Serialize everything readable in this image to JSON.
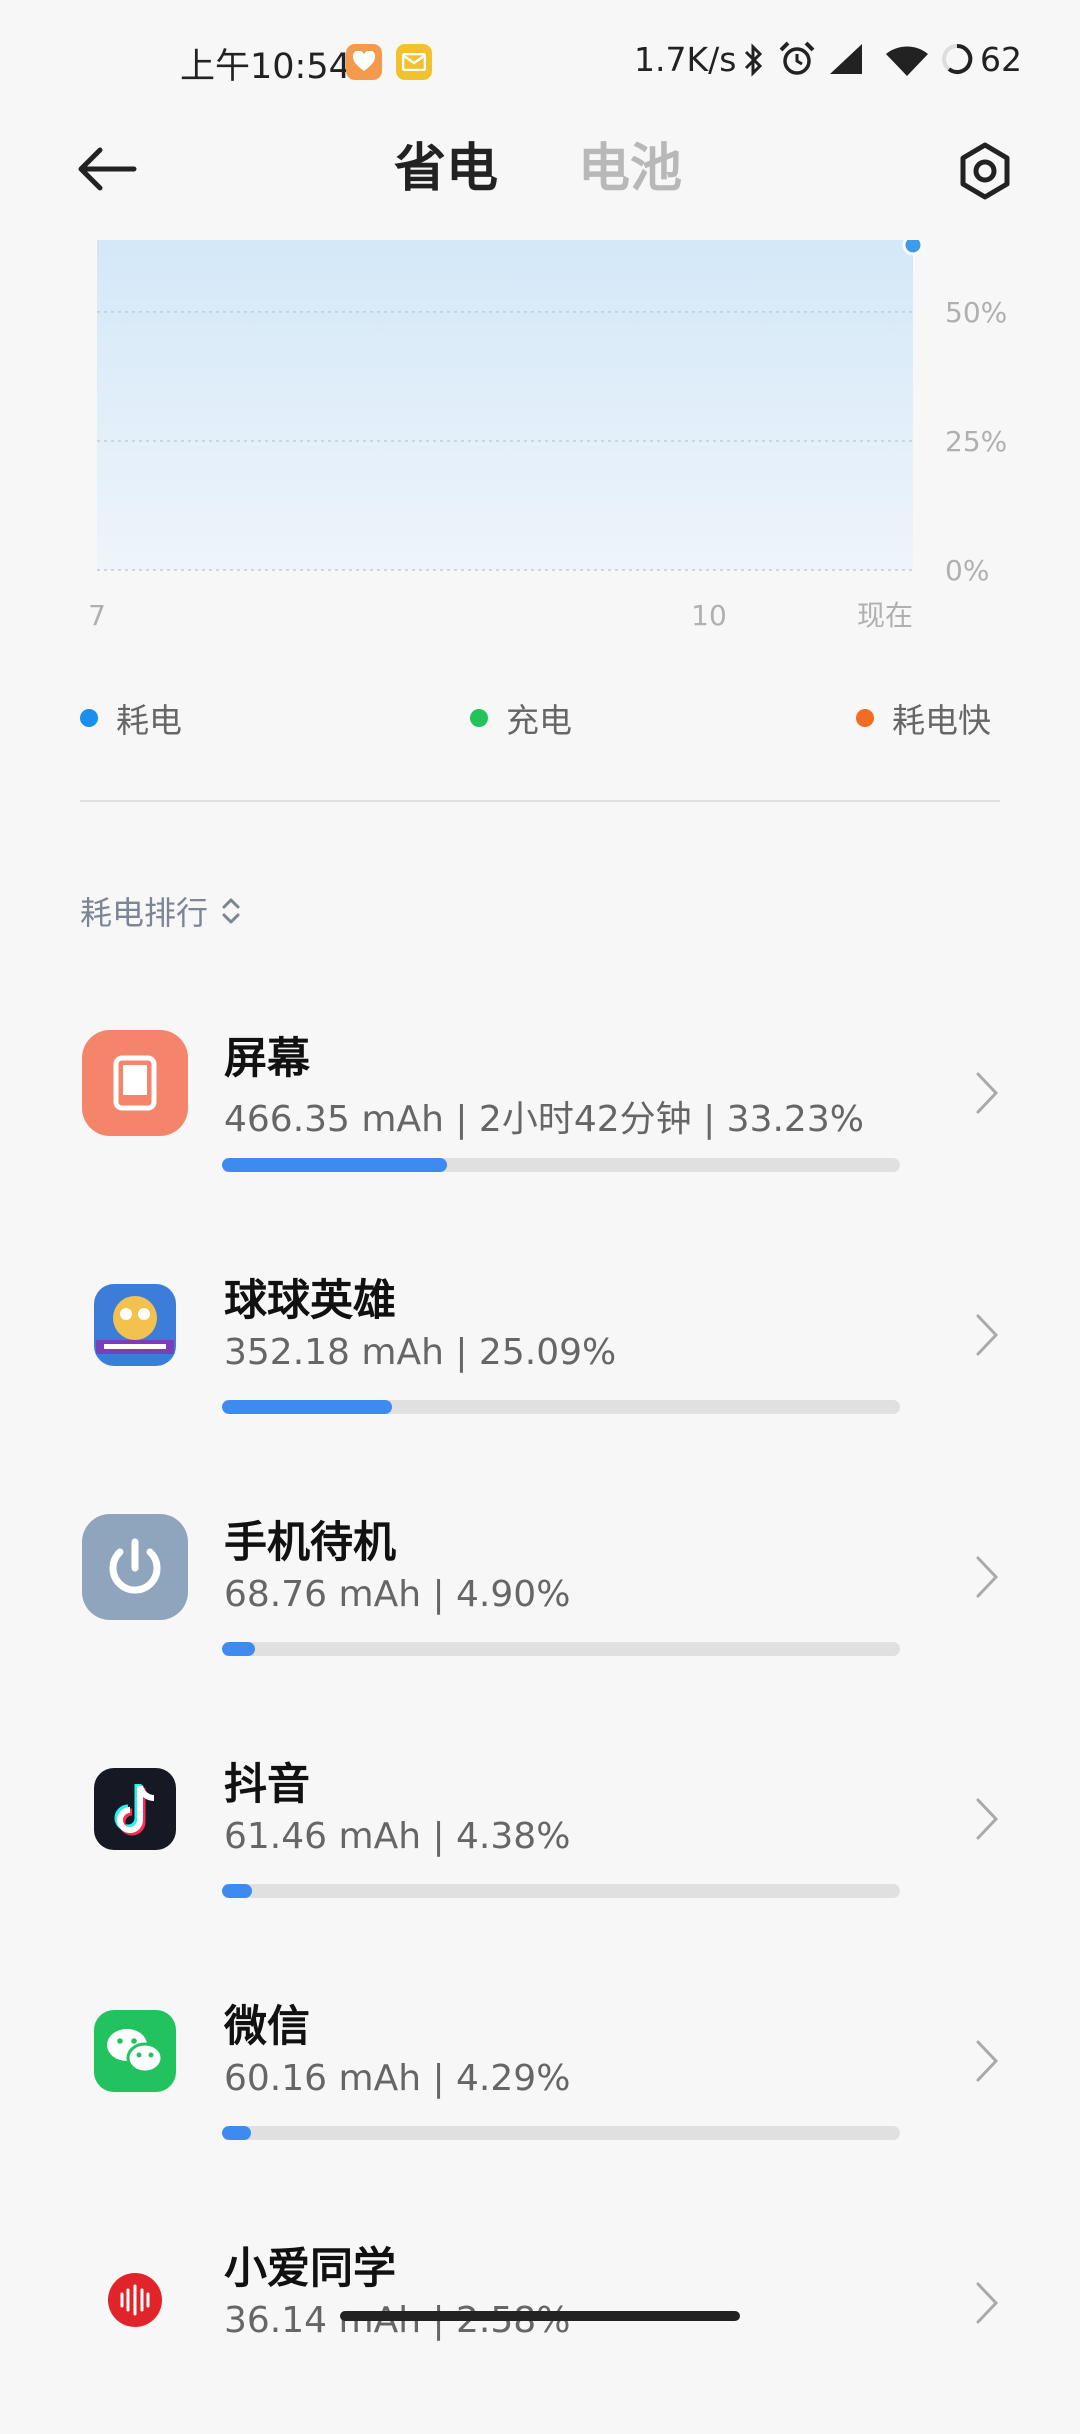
{
  "status_bar": {
    "time": "上午10:54",
    "net_speed": "1.7K/s",
    "battery": "62",
    "icons": [
      "health-app-icon",
      "mail-app-icon",
      "bluetooth-icon",
      "alarm-icon",
      "signal-icon",
      "wifi-icon",
      "battery-icon"
    ]
  },
  "header": {
    "tabs": [
      {
        "label": "省电",
        "active": true
      },
      {
        "label": "电池",
        "active": false
      }
    ]
  },
  "chart_data": {
    "type": "area",
    "x_ticks": [
      "7",
      "10",
      "现在"
    ],
    "y_ticks": [
      "0%",
      "25%",
      "50%"
    ],
    "ylim": [
      0,
      62
    ],
    "values": [
      62,
      62
    ],
    "grid": true,
    "colors": {
      "area": "#d4e8f8",
      "line": "#3d9bea"
    }
  },
  "legend": [
    {
      "label": "耗电",
      "color": "#1a8ff0"
    },
    {
      "label": "充电",
      "color": "#21c45a"
    },
    {
      "label": "耗电快",
      "color": "#f26c24"
    }
  ],
  "ranking": {
    "sort_label": "耗电排行",
    "items": [
      {
        "name": "屏幕",
        "stats": "466.35 mAh | 2小时42分钟 | 33.23%",
        "percent": 33.23,
        "icon": "screen-icon",
        "icon_color": "#f4856a"
      },
      {
        "name": "球球英雄",
        "stats": "352.18 mAh | 25.09%",
        "percent": 25.09,
        "icon": "game-app-icon",
        "icon_color": "#2a6fb8"
      },
      {
        "name": "手机待机",
        "stats": "68.76 mAh | 4.90%",
        "percent": 4.9,
        "icon": "power-icon",
        "icon_color": "#8fa5bd"
      },
      {
        "name": "抖音",
        "stats": "61.46 mAh | 4.38%",
        "percent": 4.38,
        "icon": "tiktok-icon",
        "icon_color": "#161823"
      },
      {
        "name": "微信",
        "stats": "60.16 mAh | 4.29%",
        "percent": 4.29,
        "icon": "wechat-icon",
        "icon_color": "#22c35f"
      },
      {
        "name": "小爱同学",
        "stats": "36.14 mAh | 2.58%",
        "percent": 2.58,
        "icon": "xiaoai-icon",
        "icon_color": "#e0242a"
      }
    ]
  }
}
